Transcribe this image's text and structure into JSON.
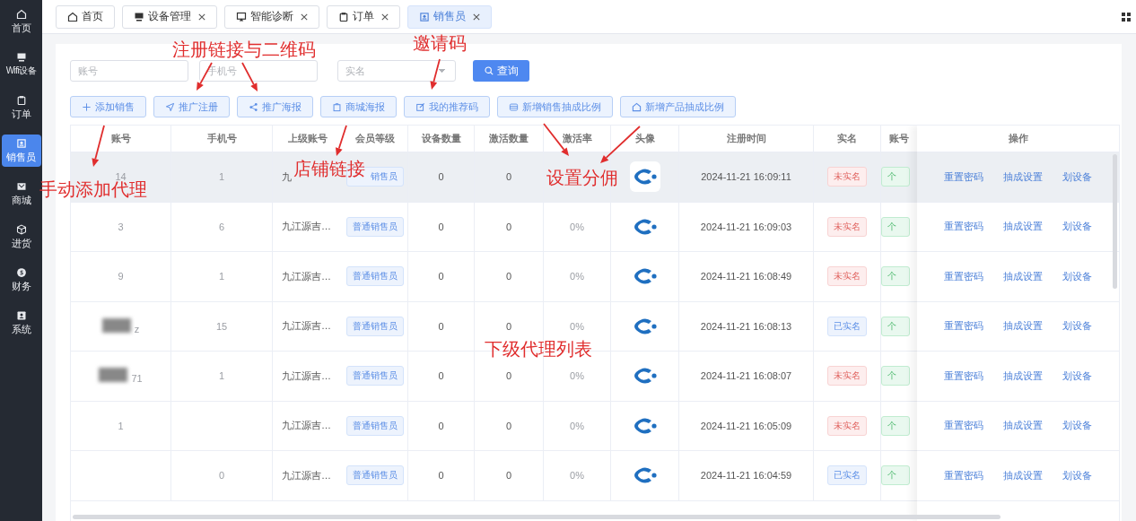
{
  "sidebar": {
    "items": [
      {
        "label": "首页",
        "selected": false
      },
      {
        "label": "Wifi设备",
        "selected": false
      },
      {
        "label": "订单",
        "selected": false
      },
      {
        "label": "销售员",
        "selected": true
      },
      {
        "label": "商城",
        "selected": false
      },
      {
        "label": "进货",
        "selected": false
      },
      {
        "label": "财务",
        "selected": false
      },
      {
        "label": "系统",
        "selected": false
      }
    ]
  },
  "tabs": [
    {
      "label": "首页",
      "closable": false,
      "selected": false
    },
    {
      "label": "设备管理",
      "closable": true,
      "selected": false
    },
    {
      "label": "智能诊断",
      "closable": true,
      "selected": false
    },
    {
      "label": "订单",
      "closable": true,
      "selected": false
    },
    {
      "label": "销售员",
      "closable": true,
      "selected": true
    }
  ],
  "filters": [
    {
      "kind": "input",
      "placeholder": "账号"
    },
    {
      "kind": "input",
      "placeholder": "手机号"
    },
    {
      "kind": "select",
      "placeholder": "实名"
    }
  ],
  "search_button": "查询",
  "toolbar": [
    "添加销售",
    "推广注册",
    "推广海报",
    "商城海报",
    "我的推荐码",
    "新增销售抽成比例",
    "新增产品抽成比例"
  ],
  "table": {
    "columns": [
      "账号",
      "手机号",
      "上级账号",
      "会员等级",
      "设备数量",
      "激活数量",
      "激活率",
      "头像",
      "注册时间",
      "实名",
      "账号",
      "操作"
    ],
    "rows": [
      {
        "highlighted": true,
        "account": "14",
        "phone": "1",
        "parent": "九",
        "level": "销售员",
        "devices": "0",
        "activated": "0",
        "time": "2024-11-21 16:09:11",
        "realname": {
          "text": "未实名",
          "verified": false
        },
        "type": "个",
        "actions": [
          "重置密码",
          "抽成设置",
          "划设备"
        ]
      },
      {
        "highlighted": false,
        "account": "3",
        "phone": "6",
        "parent": "九江源吉…",
        "level": "普通销售员",
        "devices": "0",
        "activated": "0",
        "rate": "0%",
        "time": "2024-11-21 16:09:03",
        "realname": {
          "text": "未实名",
          "verified": false
        },
        "type": "个",
        "actions": [
          "重置密码",
          "抽成设置",
          "划设备"
        ]
      },
      {
        "highlighted": false,
        "account": "9",
        "phone": "1",
        "parent": "九江源吉…",
        "level": "普通销售员",
        "devices": "0",
        "activated": "0",
        "rate": "0%",
        "time": "2024-11-21 16:08:49",
        "realname": {
          "text": "未实名",
          "verified": false
        },
        "type": "个",
        "actions": [
          "重置密码",
          "抽成设置",
          "划设备"
        ]
      },
      {
        "highlighted": false,
        "account": "z",
        "phone": "15",
        "parent": "九江源吉…",
        "level": "普通销售员",
        "devices": "0",
        "activated": "0",
        "rate": "0%",
        "time": "2024-11-21 16:08:13",
        "realname": {
          "text": "已实名",
          "verified": true
        },
        "type": "个",
        "actions": [
          "重置密码",
          "抽成设置",
          "划设备"
        ]
      },
      {
        "highlighted": false,
        "account": "71",
        "phone": "1",
        "parent": "九江源吉…",
        "level": "普通销售员",
        "devices": "0",
        "activated": "0",
        "rate": "0%",
        "time": "2024-11-21 16:08:07",
        "realname": {
          "text": "未实名",
          "verified": false
        },
        "type": "个",
        "actions": [
          "重置密码",
          "抽成设置",
          "划设备"
        ]
      },
      {
        "highlighted": false,
        "account": "1",
        "parent": "九江源吉…",
        "level": "普通销售员",
        "devices": "0",
        "activated": "0",
        "rate": "0%",
        "time": "2024-11-21 16:05:09",
        "realname": {
          "text": "未实名",
          "verified": false
        },
        "type": "个",
        "actions": [
          "重置密码",
          "抽成设置",
          "划设备"
        ]
      },
      {
        "highlighted": false,
        "phone": "0",
        "parent": "九江源吉…",
        "level": "普通销售员",
        "devices": "0",
        "activated": "0",
        "rate": "0%",
        "time": "2024-11-21 16:04:59",
        "realname": {
          "text": "已实名",
          "verified": true
        },
        "type": "个",
        "actions": [
          "重置密码",
          "抽成设置",
          "划设备"
        ]
      }
    ]
  },
  "annotations": [
    "注册链接与二维码",
    "邀请码",
    "手动添加代理",
    "店铺链接",
    "设置分佣",
    "下级代理列表"
  ]
}
